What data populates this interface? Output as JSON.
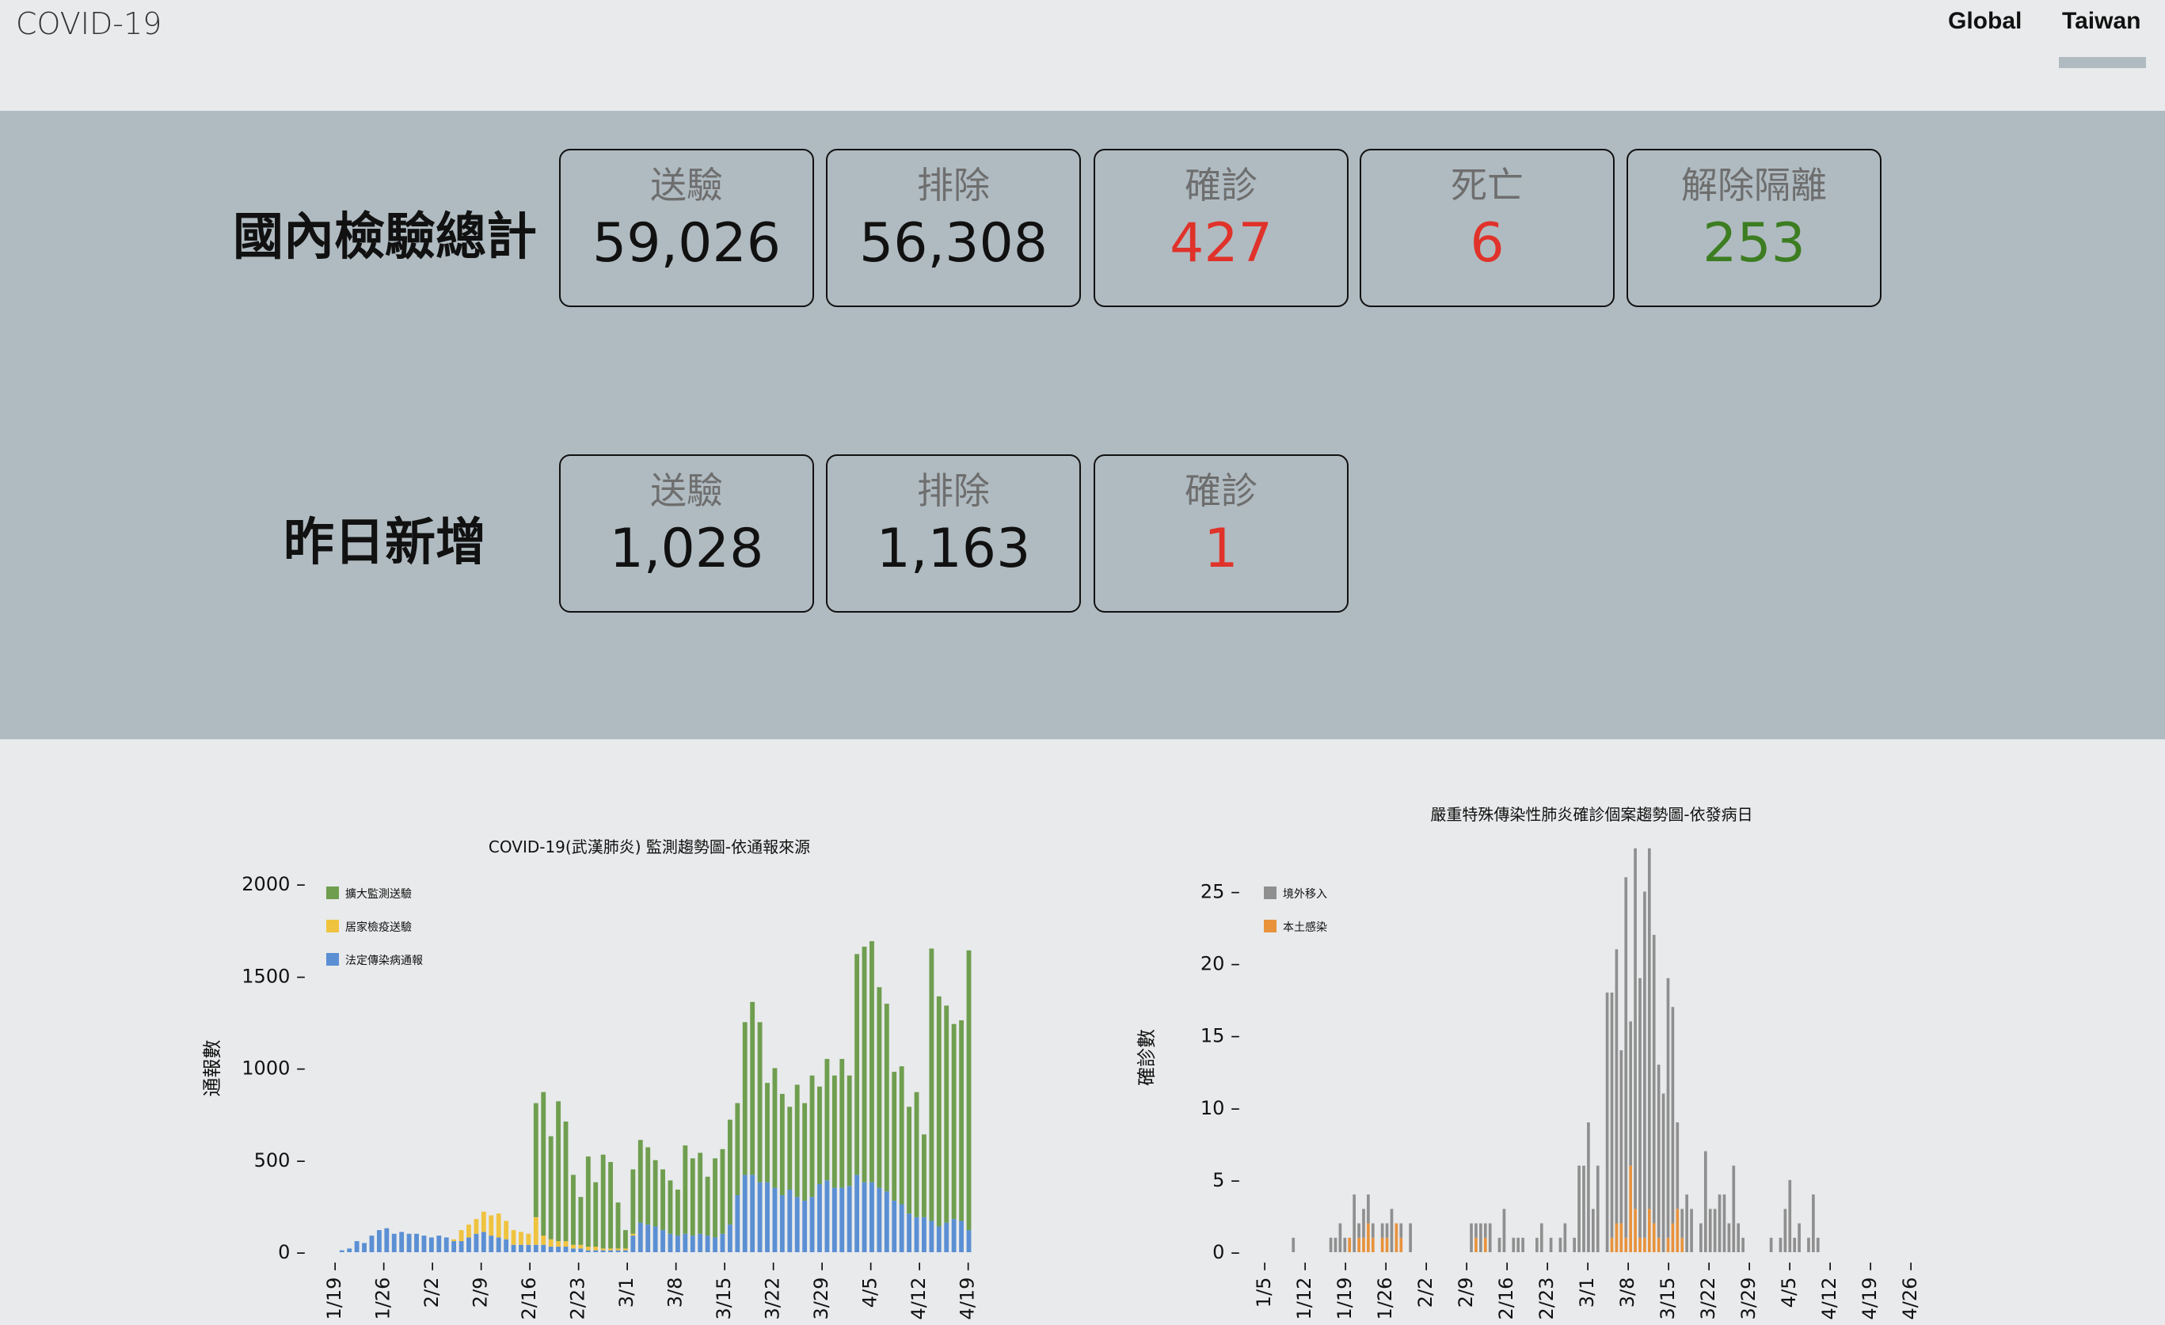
{
  "header": {
    "brand": "COVID-19",
    "nav": [
      "Global",
      "Taiwan"
    ]
  },
  "totals": {
    "title": "國內檢驗總計",
    "cards": [
      {
        "label": "送驗",
        "value": "59,026",
        "tone": "dark"
      },
      {
        "label": "排除",
        "value": "56,308",
        "tone": "dark"
      },
      {
        "label": "確診",
        "value": "427",
        "tone": "red"
      },
      {
        "label": "死亡",
        "value": "6",
        "tone": "red"
      },
      {
        "label": "解除隔離",
        "value": "253",
        "tone": "green"
      }
    ]
  },
  "yesterday": {
    "title": "昨日新增",
    "cards": [
      {
        "label": "送驗",
        "value": "1,028",
        "tone": "dark"
      },
      {
        "label": "排除",
        "value": "1,163",
        "tone": "dark"
      },
      {
        "label": "確診",
        "value": "1",
        "tone": "red"
      }
    ]
  },
  "colors": {
    "red": "#e0322a",
    "green": "#3d7d22",
    "band": "#b0bbc1",
    "page": "#e8eaeb"
  },
  "chart_data": [
    {
      "type": "bar",
      "stacked": true,
      "title": "COVID-19(武漢肺炎) 監測趨勢圖-依通報來源",
      "ylabel": "通報數",
      "xlabel": "",
      "ylim": [
        0,
        2000
      ],
      "yticks": [
        0,
        500,
        1000,
        1500,
        2000
      ],
      "xticks": [
        "1/19",
        "1/26",
        "2/2",
        "2/9",
        "2/16",
        "2/23",
        "3/1",
        "3/8",
        "3/15",
        "3/22",
        "3/29",
        "4/5",
        "4/12",
        "4/19"
      ],
      "legend_position": "top-left",
      "series": [
        {
          "name": "擴大監測送驗",
          "color": "#6f9e4f",
          "values": [
            0,
            0,
            0,
            0,
            0,
            0,
            0,
            0,
            0,
            0,
            0,
            0,
            0,
            0,
            0,
            0,
            0,
            0,
            0,
            0,
            0,
            0,
            0,
            0,
            0,
            0,
            0,
            0,
            620,
            780,
            560,
            760,
            650,
            380,
            260,
            490,
            350,
            510,
            470,
            250,
            100,
            350,
            450,
            420,
            360,
            330,
            290,
            250,
            480,
            420,
            440,
            320,
            430,
            460,
            570,
            500,
            830,
            940,
            870,
            540,
            650,
            550,
            450,
            610,
            530,
            660,
            530,
            660,
            610,
            700,
            600,
            1200,
            1280,
            1310,
            1090,
            1020,
            700,
            750,
            580,
            680,
            450,
            1480,
            1250,
            1180,
            1060,
            1090,
            1520
          ]
        },
        {
          "name": "居家檢疫送驗",
          "color": "#f0c33f",
          "values": [
            0,
            0,
            0,
            0,
            0,
            0,
            0,
            0,
            0,
            0,
            0,
            0,
            0,
            0,
            0,
            0,
            0,
            10,
            60,
            70,
            80,
            110,
            110,
            130,
            100,
            80,
            70,
            60,
            150,
            50,
            40,
            30,
            30,
            20,
            20,
            20,
            20,
            10,
            10,
            10,
            10,
            10,
            0,
            0,
            0,
            0,
            0,
            0,
            0,
            0,
            0,
            0,
            0,
            0,
            0,
            0,
            0,
            0,
            0,
            0,
            0,
            0,
            0,
            0,
            0,
            0,
            0,
            0,
            0,
            0,
            0,
            0,
            0,
            0,
            0,
            0,
            0,
            0,
            0,
            0,
            0,
            0,
            0,
            0,
            0,
            0,
            0
          ]
        },
        {
          "name": "法定傳染病通報",
          "color": "#5b8fd4",
          "values": [
            0,
            0,
            10,
            20,
            60,
            50,
            90,
            120,
            130,
            100,
            110,
            100,
            100,
            90,
            80,
            90,
            80,
            60,
            60,
            80,
            100,
            110,
            90,
            80,
            70,
            40,
            40,
            40,
            40,
            40,
            30,
            30,
            30,
            20,
            20,
            10,
            10,
            10,
            10,
            10,
            10,
            90,
            160,
            150,
            140,
            120,
            100,
            90,
            100,
            90,
            100,
            90,
            80,
            100,
            150,
            310,
            420,
            420,
            380,
            380,
            350,
            310,
            340,
            300,
            280,
            300,
            370,
            390,
            350,
            350,
            360,
            420,
            380,
            380,
            350,
            330,
            280,
            260,
            210,
            190,
            190,
            170,
            140,
            160,
            180,
            170,
            120
          ]
        }
      ]
    },
    {
      "type": "bar",
      "stacked": true,
      "title": "嚴重特殊傳染性肺炎確診個案趨勢圖-依發病日",
      "ylabel": "確診數",
      "xlabel": "",
      "ylim": [
        0,
        27
      ],
      "yticks": [
        0,
        5,
        10,
        15,
        20,
        25
      ],
      "xticks": [
        "1/5",
        "1/12",
        "1/19",
        "1/26",
        "2/2",
        "2/9",
        "2/16",
        "2/23",
        "3/1",
        "3/8",
        "3/15",
        "3/22",
        "3/29",
        "4/5",
        "4/12",
        "4/19",
        "4/26"
      ],
      "legend_position": "top-left",
      "series": [
        {
          "name": "境外移入",
          "color": "#8f8f8f",
          "values": [
            0,
            0,
            0,
            0,
            0,
            0,
            0,
            1,
            0,
            0,
            0,
            0,
            0,
            0,
            0,
            1,
            1,
            2,
            1,
            0,
            4,
            1,
            2,
            2,
            1,
            0,
            1,
            1,
            3,
            0,
            1,
            0,
            2,
            0,
            0,
            0,
            0,
            0,
            0,
            0,
            0,
            0,
            0,
            0,
            0,
            2,
            1,
            2,
            1,
            2,
            0,
            1,
            3,
            0,
            1,
            1,
            1,
            0,
            0,
            1,
            2,
            0,
            1,
            0,
            1,
            2,
            0,
            1,
            6,
            6,
            9,
            3,
            6,
            0,
            18,
            17,
            19,
            12,
            25,
            10,
            25,
            18,
            24,
            25,
            20,
            12,
            11,
            18,
            15,
            6,
            2,
            4,
            3,
            0,
            2,
            7,
            3,
            3,
            4,
            4,
            2,
            6,
            2,
            1,
            0,
            0,
            0,
            0,
            0,
            1,
            0,
            1,
            3,
            5,
            1,
            2,
            0,
            1,
            4,
            1,
            0,
            0,
            0,
            0,
            0,
            0,
            0,
            0,
            0,
            0,
            0,
            0,
            0,
            0,
            0,
            0,
            0,
            0,
            0,
            0,
            0,
            0
          ]
        },
        {
          "name": "本土感染",
          "color": "#e8923c",
          "values": [
            0,
            0,
            0,
            0,
            0,
            0,
            0,
            0,
            0,
            0,
            0,
            0,
            0,
            0,
            0,
            0,
            0,
            0,
            0,
            1,
            0,
            1,
            1,
            2,
            1,
            0,
            1,
            1,
            0,
            2,
            1,
            0,
            0,
            0,
            0,
            0,
            0,
            0,
            0,
            0,
            0,
            0,
            0,
            0,
            0,
            0,
            1,
            0,
            1,
            0,
            0,
            0,
            0,
            0,
            0,
            0,
            0,
            0,
            0,
            0,
            0,
            0,
            0,
            0,
            0,
            0,
            0,
            0,
            0,
            0,
            0,
            0,
            0,
            0,
            0,
            1,
            2,
            2,
            1,
            6,
            3,
            1,
            1,
            3,
            2,
            1,
            0,
            1,
            2,
            3,
            1,
            0,
            0,
            0,
            0,
            0,
            0,
            0,
            0,
            0,
            0,
            0,
            0,
            0,
            0,
            0,
            0,
            0,
            0,
            0,
            0,
            0,
            0,
            0,
            0,
            0,
            0,
            0,
            0,
            0,
            0,
            0,
            0,
            0,
            0,
            0,
            0,
            0,
            0,
            0,
            0,
            0,
            0,
            0,
            0,
            0,
            0,
            0,
            0,
            0,
            0,
            0
          ]
        }
      ]
    }
  ]
}
